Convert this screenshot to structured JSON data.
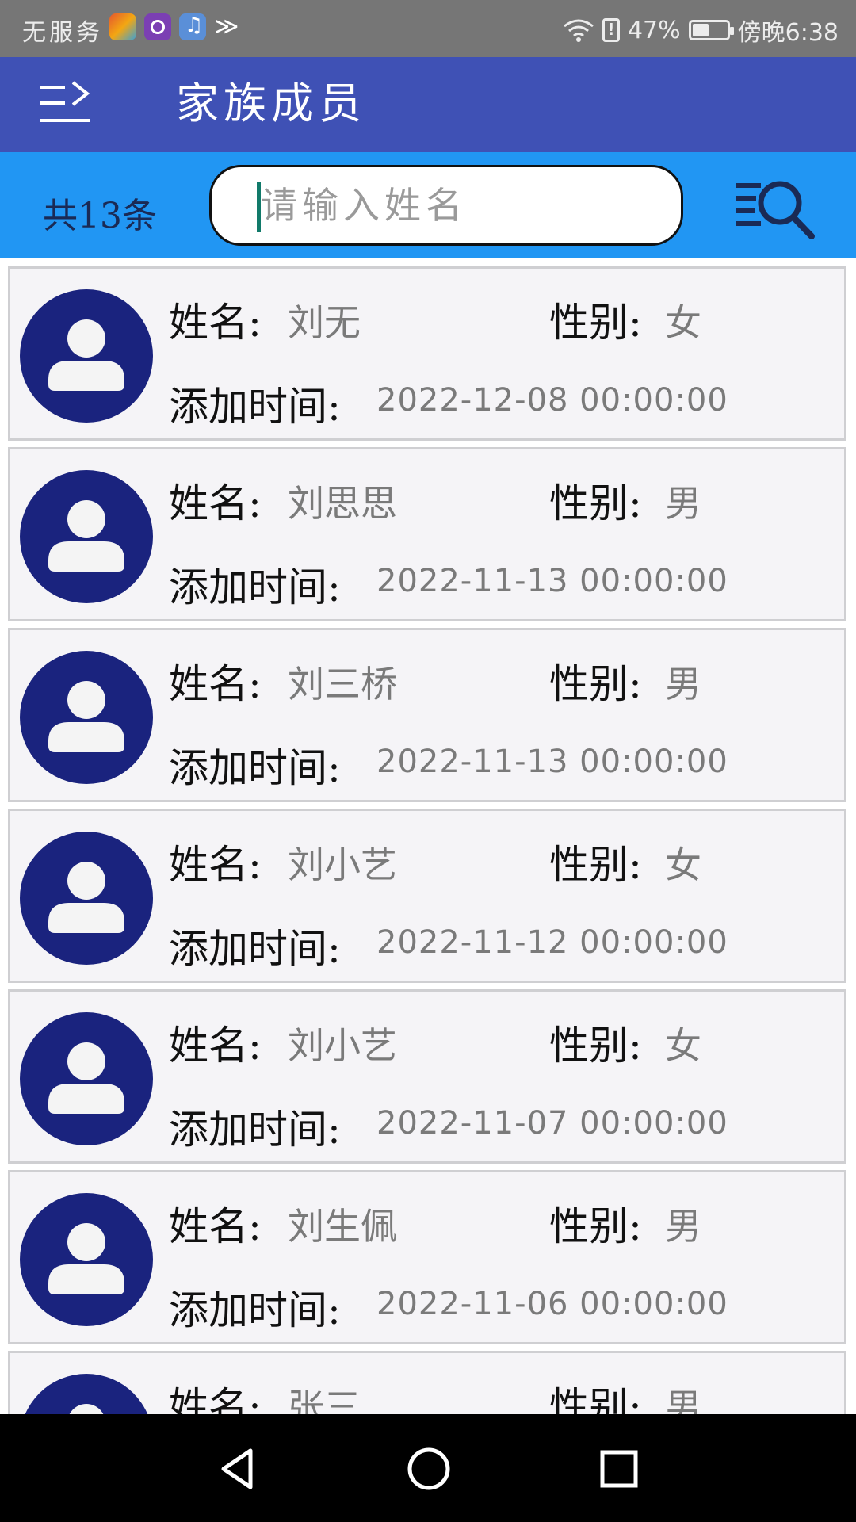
{
  "status_bar": {
    "carrier_text": "无服务",
    "battery": "47%",
    "battery_level": 0.47,
    "time": "傍晚6:38",
    "icons": [
      "game-app-icon",
      "browser-app-icon",
      "music-app-icon",
      "signal-app-icon",
      "wifi-icon",
      "alert-icon",
      "battery-icon"
    ]
  },
  "app_bar": {
    "title": "家族成员",
    "menu_icon": "menu-arrow-icon"
  },
  "search": {
    "count_text": "共13条",
    "placeholder": "请输入姓名",
    "value": "",
    "search_icon": "list-search-icon"
  },
  "labels": {
    "name": "姓名:",
    "gender": "性别:",
    "added_time": "添加时间:"
  },
  "members": [
    {
      "name": "刘无",
      "gender": "女",
      "added": "2022-12-08  00:00:00"
    },
    {
      "name": "刘思思",
      "gender": "男",
      "added": "2022-11-13  00:00:00"
    },
    {
      "name": "刘三桥",
      "gender": "男",
      "added": "2022-11-13  00:00:00"
    },
    {
      "name": "刘小艺",
      "gender": "女",
      "added": "2022-11-12  00:00:00"
    },
    {
      "name": "刘小艺",
      "gender": "女",
      "added": "2022-11-07  00:00:00"
    },
    {
      "name": "刘生佩",
      "gender": "男",
      "added": "2022-11-06  00:00:00"
    },
    {
      "name": "张三",
      "gender": "男",
      "added": ""
    }
  ],
  "colors": {
    "app_bar": "#3f51b5",
    "search_bar": "#2196f3",
    "avatar": "#1a237e",
    "row_bg": "#f5f4f7"
  },
  "nav_bar": {
    "icons": [
      "back-icon",
      "home-icon",
      "recents-icon"
    ]
  }
}
